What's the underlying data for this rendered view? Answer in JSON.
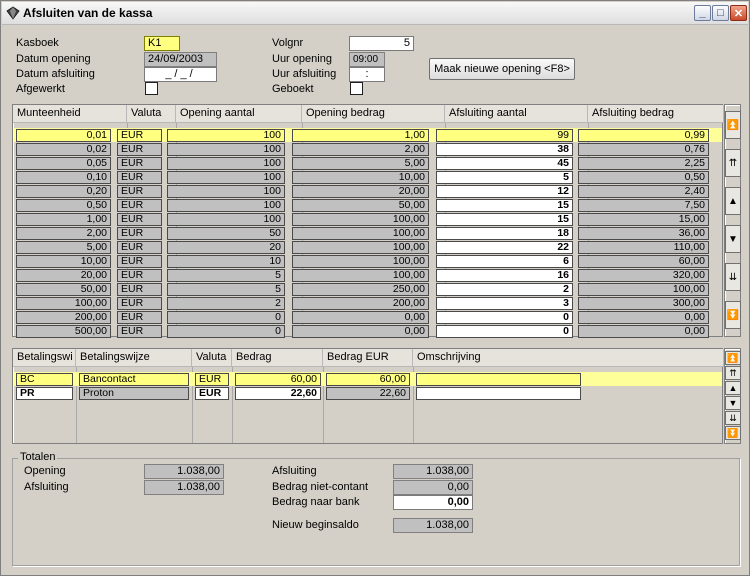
{
  "window": {
    "title": "Afsluiten van de kassa",
    "buttons": {
      "minimize": "_",
      "maximize": "□",
      "close": "✕"
    }
  },
  "form": {
    "kasboek_label": "Kasboek",
    "kasboek_value": "K1",
    "datum_opening_label": "Datum opening",
    "datum_opening_value": "24/09/2003",
    "datum_afsluiting_label": "Datum afsluiting",
    "datum_afsluiting_value": "_/_/",
    "afgewerkt_label": "Afgewerkt",
    "volgnr_label": "Volgnr",
    "volgnr_value": "5",
    "uur_opening_label": "Uur opening",
    "uur_opening_value": "09:00",
    "uur_afsluiting_label": "Uur afsluiting",
    "uur_afsluiting_value": ":",
    "geboekt_label": "Geboekt",
    "new_opening_button": "Maak nieuwe opening <F8>"
  },
  "coins_table": {
    "headers": [
      "Munteenheid",
      "Valuta",
      "Opening aantal",
      "Opening bedrag",
      "Afsluiting aantal",
      "Afsluiting bedrag"
    ],
    "rows": [
      [
        "0,01",
        "EUR",
        "100",
        "1,00",
        "99",
        "0,99"
      ],
      [
        "0,02",
        "EUR",
        "100",
        "2,00",
        "38",
        "0,76"
      ],
      [
        "0,05",
        "EUR",
        "100",
        "5,00",
        "45",
        "2,25"
      ],
      [
        "0,10",
        "EUR",
        "100",
        "10,00",
        "5",
        "0,50"
      ],
      [
        "0,20",
        "EUR",
        "100",
        "20,00",
        "12",
        "2,40"
      ],
      [
        "0,50",
        "EUR",
        "100",
        "50,00",
        "15",
        "7,50"
      ],
      [
        "1,00",
        "EUR",
        "100",
        "100,00",
        "15",
        "15,00"
      ],
      [
        "2,00",
        "EUR",
        "50",
        "100,00",
        "18",
        "36,00"
      ],
      [
        "5,00",
        "EUR",
        "20",
        "100,00",
        "22",
        "110,00"
      ],
      [
        "10,00",
        "EUR",
        "10",
        "100,00",
        "6",
        "60,00"
      ],
      [
        "20,00",
        "EUR",
        "5",
        "100,00",
        "16",
        "320,00"
      ],
      [
        "50,00",
        "EUR",
        "5",
        "250,00",
        "2",
        "100,00"
      ],
      [
        "100,00",
        "EUR",
        "2",
        "200,00",
        "3",
        "300,00"
      ],
      [
        "200,00",
        "EUR",
        "0",
        "0,00",
        "0",
        "0,00"
      ],
      [
        "500,00",
        "EUR",
        "0",
        "0,00",
        "0",
        "0,00"
      ]
    ],
    "nav": [
      "⏫",
      "⇈",
      "▲",
      "▼",
      "⇊",
      "⏬"
    ]
  },
  "payment_table": {
    "headers": [
      "Betalingswi",
      "Betalingswijze",
      "Valuta",
      "Bedrag",
      "Bedrag EUR",
      "Omschrijving"
    ],
    "rows": [
      [
        "BC",
        "Bancontact",
        "EUR",
        "60,00",
        "60,00",
        ""
      ],
      [
        "PR",
        "Proton",
        "EUR",
        "22,60",
        "22,60",
        ""
      ]
    ]
  },
  "totals": {
    "group_title": "Totalen",
    "opening_label": "Opening",
    "opening_value": "1.038,00",
    "afsluiting_label": "Afsluiting",
    "afsluiting_value": "1.038,00",
    "right_afsluiting_label": "Afsluiting",
    "right_afsluiting_value": "1.038,00",
    "niet_contant_label": "Bedrag niet-contant",
    "niet_contant_value": "0,00",
    "naar_bank_label": "Bedrag naar bank",
    "naar_bank_value": "0,00",
    "nieuw_beginsaldo_label": "Nieuw beginsaldo",
    "nieuw_beginsaldo_value": "1.038,00"
  }
}
